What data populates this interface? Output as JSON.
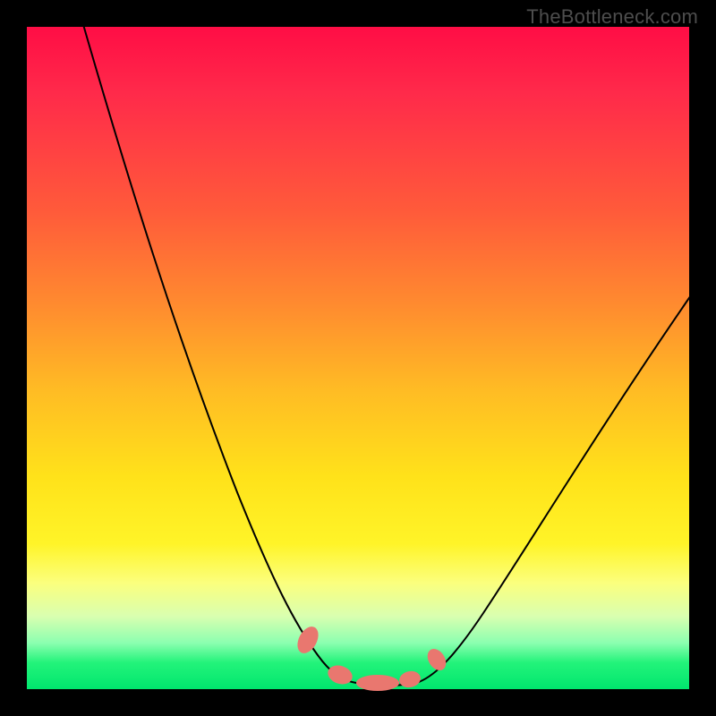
{
  "watermark": "TheBottleneck.com",
  "colors": {
    "gradient_top": "#ff0d45",
    "gradient_mid": "#ffe21a",
    "gradient_bottom": "#00e66e",
    "blob": "#e9776f",
    "frame": "#000000",
    "curve": "#000000"
  },
  "chart_data": {
    "type": "line",
    "title": "",
    "xlabel": "",
    "ylabel": "",
    "xlim": [
      0,
      100
    ],
    "ylim": [
      0,
      100
    ],
    "note": "No axis ticks or numeric labels are rendered in the image; x/y values are normalized 0–100 estimates read from pixel positions. y=100 is top (red), y=0 is bottom (green).",
    "series": [
      {
        "name": "bottleneck-curve",
        "x": [
          10,
          15,
          20,
          25,
          30,
          35,
          40,
          43,
          46,
          50,
          55,
          58,
          60,
          65,
          70,
          80,
          90,
          100
        ],
        "y": [
          100,
          85,
          70,
          55,
          41,
          27,
          14,
          8,
          4,
          1,
          0.5,
          1,
          3,
          10,
          18,
          34,
          48,
          60
        ]
      }
    ],
    "markers": [
      {
        "name": "left-entry-blob",
        "x": 43,
        "y": 8
      },
      {
        "name": "trough-blob-left",
        "x": 48,
        "y": 1.5
      },
      {
        "name": "trough-blob-mid",
        "x": 52,
        "y": 0.5
      },
      {
        "name": "trough-blob-right",
        "x": 56,
        "y": 1
      },
      {
        "name": "right-exit-blob",
        "x": 60,
        "y": 4
      }
    ]
  }
}
